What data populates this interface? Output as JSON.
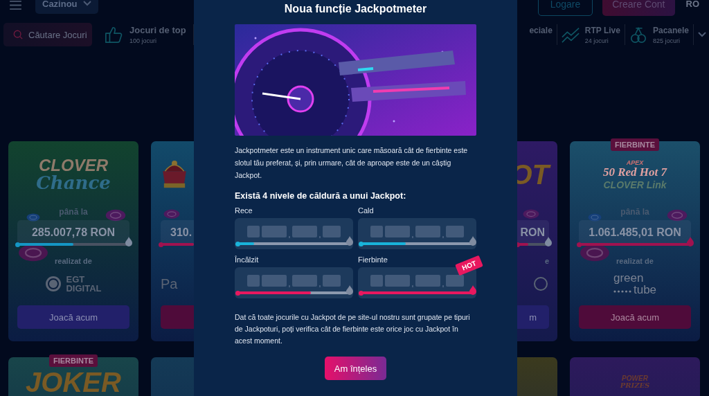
{
  "header": {
    "casino_dropdown": "Cazinou",
    "login_button": "Logare",
    "signup_button": "Creare Cont",
    "language": "RO"
  },
  "categories": {
    "search": {
      "placeholder": "Căutare Jocuri"
    },
    "left": [
      {
        "title": "Jocuri de top",
        "count": "100 jocuri",
        "kind": "thumb"
      }
    ],
    "right": [
      {
        "title": "eciale",
        "kind": "text"
      },
      {
        "title": "RTP Live",
        "count": "24 jocuri",
        "kind": "trend"
      },
      {
        "title": "Pacanele",
        "count": "825 jocuri",
        "kind": "cherry"
      }
    ]
  },
  "cards": [
    {
      "kind": "full",
      "logo": [
        "CLOVER",
        "Chance"
      ],
      "label": "până la",
      "amount": "285.007,78 RON",
      "meter": {
        "level": 0.5,
        "color": "#1596c4"
      },
      "made_by": "realizat de",
      "provider": [
        "EGT",
        "DIGITAL"
      ],
      "button": {
        "label": "Joacă acum",
        "color": "#22206a"
      }
    },
    {
      "kind": "cut_right",
      "amount": "310.",
      "meter": {
        "level": 1,
        "color": "#a0124f"
      },
      "provider": [
        "Pa"
      ],
      "button": {
        "color": "#4f0b3a"
      }
    },
    {
      "kind": "cut_left",
      "logo": [
        "OT"
      ],
      "amount": "RON",
      "meter": {
        "level": 0.35,
        "color": "#a0124f"
      },
      "made_by": "e",
      "button": {
        "label": "m",
        "color": "#22206a"
      }
    },
    {
      "kind": "full",
      "badge": "FIERBINTE",
      "logo": [
        "APEX",
        "50 Red Hot 7",
        "CLOVER Link"
      ],
      "label": "până la",
      "amount": "1.061.485,01 RON",
      "meter": {
        "level": 1,
        "color": "#a0124f"
      },
      "made_by": "realizat de",
      "provider": [
        "green",
        "tube"
      ],
      "button": {
        "label": "Joacă acum",
        "color": "#4f0b3a"
      }
    }
  ],
  "cards_row2": [
    {
      "kind": "full",
      "color": "#18454a",
      "badge": "FIERBINTE",
      "logo": [
        "JOKER"
      ]
    },
    {
      "kind": "cut_right",
      "color": "#143a56"
    },
    {
      "kind": "cut_left",
      "color": "#3b3a1e"
    },
    {
      "kind": "full",
      "color": "#2d1a5c",
      "logo": [
        "POWER",
        "PRIZES"
      ]
    }
  ],
  "dialog": {
    "title": "Noua funcție Jackpotmeter",
    "intro": "Jackpotmeter este un instrument unic care măsoară cât de fierbinte este slotul tău preferat, și, prin urmare, cât de aproape este de un câștig Jackpot.",
    "levels_heading": "Există 4 nivele de căldură a unui Jackpot:",
    "levels": [
      {
        "label": "Rece",
        "level": 0.15,
        "color": "#19b3da"
      },
      {
        "label": "Cald",
        "level": 0.4,
        "color": "#19b3da"
      },
      {
        "label": "Încălzit",
        "level": 0.65,
        "color": "#e8185f"
      },
      {
        "label": "Fierbinte",
        "level": 1,
        "color": "#e8185f",
        "badge": "HOT"
      }
    ],
    "note": "Dat că toate jocurile cu Jackpot de pe site-ul nostru sunt grupate pe tipuri de Jackpoturi, poți verifica cât de fierbinte este orice joc cu Jackpot în acest moment.",
    "button": "Am înțeles"
  }
}
